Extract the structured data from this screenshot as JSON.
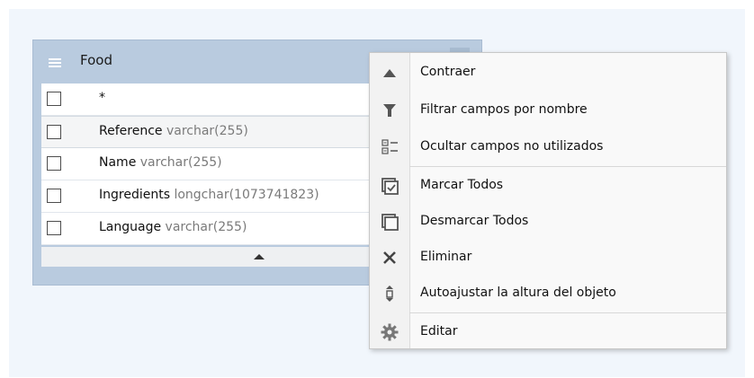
{
  "table": {
    "title": "Food",
    "rows": [
      {
        "name": "*",
        "type": ""
      },
      {
        "name": "Reference",
        "type": "varchar(255)"
      },
      {
        "name": "Name",
        "type": "varchar(255)"
      },
      {
        "name": "Ingredients",
        "type": "longchar(1073741823)"
      },
      {
        "name": "Language",
        "type": "varchar(255)"
      }
    ]
  },
  "context_menu": {
    "items": [
      {
        "label": "Contraer",
        "icon": "collapse-up-icon"
      },
      {
        "label": "Filtrar campos por nombre",
        "icon": "filter-icon"
      },
      {
        "label": "Ocultar campos no utilizados",
        "icon": "hide-fields-icon"
      },
      {
        "label": "Marcar Todos",
        "icon": "check-all-icon"
      },
      {
        "label": "Desmarcar Todos",
        "icon": "uncheck-all-icon"
      },
      {
        "label": "Eliminar",
        "icon": "delete-icon"
      },
      {
        "label": "Autoajustar la altura del objeto",
        "icon": "autofit-height-icon"
      },
      {
        "label": "Editar",
        "icon": "gear-icon"
      }
    ]
  },
  "colors": {
    "canvas": "#f1f6fc",
    "table_frame": "#b9cbdf",
    "menu_bg": "#f9f9f9",
    "icon": "#555555"
  }
}
